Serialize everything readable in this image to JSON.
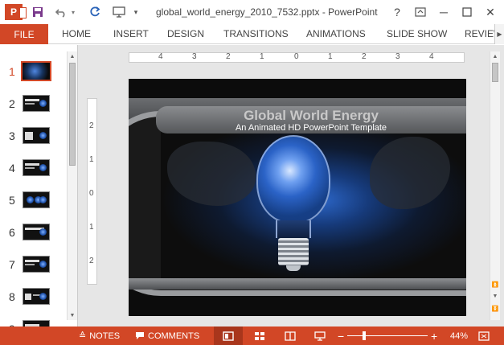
{
  "titlebar": {
    "title": "global_world_energy_2010_7532.pptx - PowerPoint",
    "app_icon": "P",
    "help": "?",
    "minimize": "─",
    "close": "✕"
  },
  "ribbon": {
    "file": "FILE",
    "tabs": [
      "HOME",
      "INSERT",
      "DESIGN",
      "TRANSITIONS",
      "ANIMATIONS",
      "SLIDE SHOW",
      "REVIEW"
    ]
  },
  "thumbnails": {
    "numbers": [
      "1",
      "2",
      "3",
      "4",
      "5",
      "6",
      "7",
      "8",
      "9"
    ],
    "selected": 1
  },
  "ruler": {
    "h_labels": [
      "4",
      "3",
      "2",
      "1",
      "0",
      "1",
      "2",
      "3",
      "4"
    ],
    "v_labels": [
      "2",
      "1",
      "0",
      "1",
      "2"
    ]
  },
  "slide": {
    "title": "Global World Energy",
    "subtitle": "An Animated HD PowerPoint Template"
  },
  "status": {
    "notes": "NOTES",
    "comments": "COMMENTS",
    "zoom_minus": "−",
    "zoom_plus": "+",
    "zoom_value": "44%"
  },
  "colors": {
    "accent": "#d24726"
  }
}
